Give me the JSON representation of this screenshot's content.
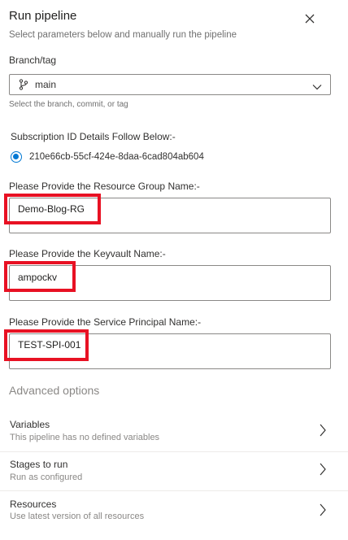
{
  "header": {
    "title": "Run pipeline",
    "subtitle": "Select parameters below and manually run the pipeline"
  },
  "branch": {
    "label": "Branch/tag",
    "value": "main",
    "helper": "Select the branch, commit, or tag"
  },
  "subscription": {
    "label": "Subscription ID Details Follow Below:-",
    "selected_option": "210e66cb-55cf-424e-8daa-6cad804ab604"
  },
  "fields": {
    "resource_group": {
      "label": "Please Provide the Resource Group Name:-",
      "value": "Demo-Blog-RG"
    },
    "keyvault": {
      "label": "Please Provide the Keyvault Name:-",
      "value": "ampockv"
    },
    "service_principal": {
      "label": "Please Provide the Service Principal Name:-",
      "value": "TEST-SPI-001"
    }
  },
  "advanced": {
    "title": "Advanced options",
    "rows": [
      {
        "title": "Variables",
        "subtitle": "This pipeline has no defined variables"
      },
      {
        "title": "Stages to run",
        "subtitle": "Run as configured"
      },
      {
        "title": "Resources",
        "subtitle": "Use latest version of all resources"
      }
    ]
  },
  "colors": {
    "accent": "#0078d4",
    "highlight": "#e81123"
  },
  "icons": [
    "close-icon",
    "branch-icon",
    "chevron-down-icon",
    "chevron-right-icon"
  ]
}
